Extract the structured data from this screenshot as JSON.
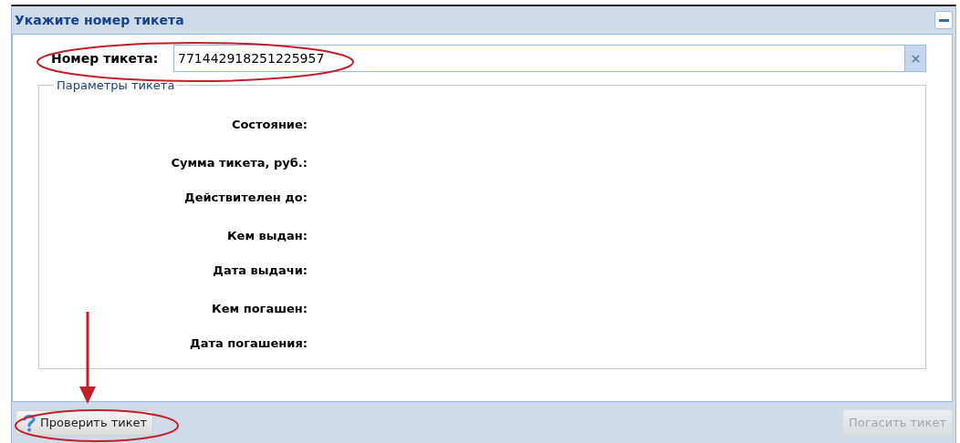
{
  "window": {
    "title": "Укажите номер тикета",
    "collapsed": false
  },
  "ticket_field": {
    "label": "Номер тикета:",
    "value": "771442918251225957"
  },
  "params": {
    "legend": "Параметры тикета",
    "groups": [
      [
        {
          "label": "Состояние:"
        }
      ],
      [
        {
          "label": "Сумма тикета, руб.:"
        },
        {
          "label": "Действителен до:"
        }
      ],
      [
        {
          "label": "Кем выдан:"
        },
        {
          "label": "Дата выдачи:"
        }
      ],
      [
        {
          "label": "Кем погашен:"
        },
        {
          "label": "Дата погашения:"
        }
      ]
    ]
  },
  "buttons": [
    {
      "kind": "help",
      "label": "Проверить тикет",
      "disabled": false
    },
    {
      "kind": "plain",
      "label": "Погасить тикет",
      "disabled": true
    }
  ]
}
